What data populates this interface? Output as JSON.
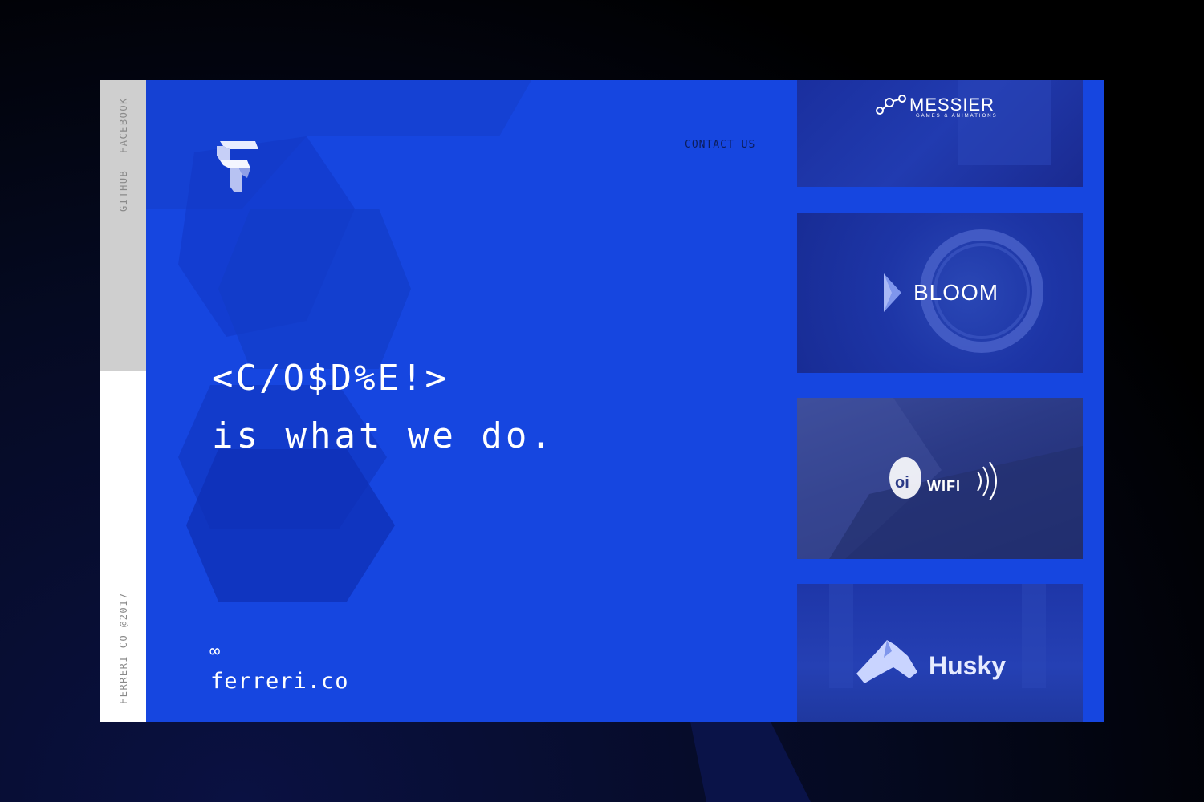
{
  "sidebar": {
    "links": [
      "FACEBOOK",
      "GITHUB"
    ],
    "copyright": "FERRERI CO @2017"
  },
  "header": {
    "contact_label": "CONTACT US"
  },
  "hero": {
    "line1": "<C/O$D%E!>",
    "line2": "is what we do."
  },
  "footer": {
    "infinity": "∞",
    "domain": "ferreri.co"
  },
  "projects": [
    {
      "name": "MESSIER",
      "tagline": "GAMES & ANIMATIONS"
    },
    {
      "name": "BLOOM"
    },
    {
      "name": "WIFI",
      "brand": "oi"
    },
    {
      "name": "Husky"
    }
  ],
  "colors": {
    "primary_blue": "#1646e0",
    "rail_grey": "#cfcfcf",
    "contact_text": "#0c1d5a"
  }
}
